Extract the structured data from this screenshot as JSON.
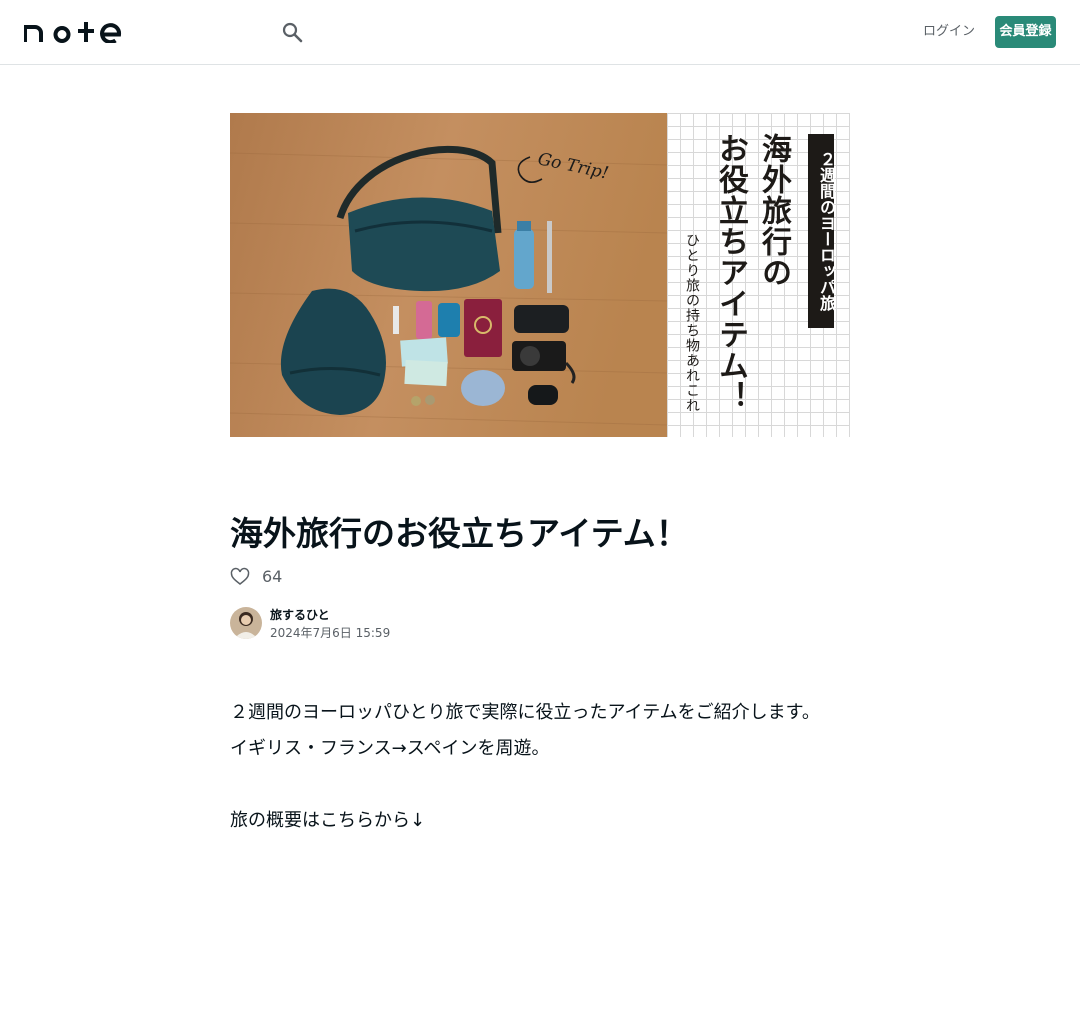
{
  "header": {
    "logo_text": "note",
    "search_icon": "search-icon",
    "login_label": "ログイン",
    "signup_label": "会員登録",
    "accent_color": "#2a8a78"
  },
  "hero": {
    "tag": "２週間のヨーロッパ旅",
    "title_line1": "海外旅行の",
    "title_line2": "お役立ちアイテム！",
    "subtitle": "ひとり旅の持ち物あれこれ",
    "handwriting": "Go Trip!"
  },
  "article": {
    "title": "海外旅行のお役立ちアイテム！",
    "like_icon": "heart-icon",
    "like_count": "64",
    "author_name": "旅するひと",
    "date": "2024年7月6日 15:59",
    "body": [
      "２週間のヨーロッパひとり旅で実際に役立ったアイテムをご紹介します。",
      "イギリス・フランス→スペインを周遊。",
      "",
      "旅の概要はこちらから↓"
    ]
  }
}
